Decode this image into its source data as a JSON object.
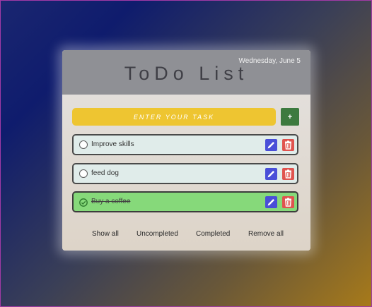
{
  "header": {
    "date": "Wednesday, June 5",
    "title": "ToDo List"
  },
  "input": {
    "placeholder": "ENTER YOUR TASK",
    "add_label": "+"
  },
  "tasks": [
    {
      "label": "Improve skills",
      "completed": false
    },
    {
      "label": "feed dog",
      "completed": false
    },
    {
      "label": "Buy a coffee",
      "completed": true
    }
  ],
  "filters": {
    "show_all": "Show all",
    "uncompleted": "Uncompleted",
    "completed": "Completed",
    "remove_all": "Remove all"
  },
  "colors": {
    "input_bg": "#eec531",
    "add_button": "#3d7a3f",
    "task_bg": "#e0ecea",
    "completed_task_bg": "#86d97a",
    "edit_icon": "#4a4fd8",
    "delete_icon": "#e0534f",
    "header_bg": "#8f9095"
  }
}
